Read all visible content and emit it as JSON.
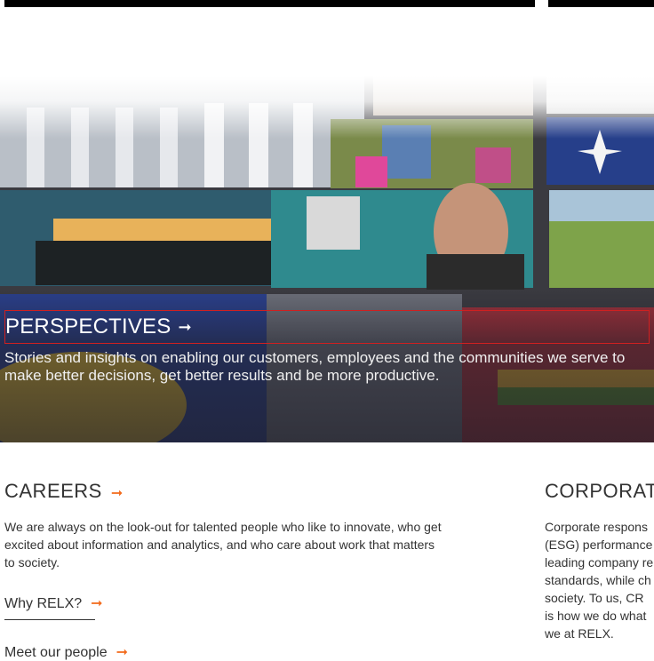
{
  "hero": {
    "title": "PERSPECTIVES",
    "arrow": "➞",
    "description": "Stories and insights on enabling our customers, employees and the communities we serve to make better decisions, get better results and be more productive."
  },
  "careers": {
    "title": "CAREERS",
    "arrow": "➞",
    "body": "We are always on the look-out for talented people who like to innovate, who get excited about information and analytics, and who care about work that matters to society.",
    "link1": "Why RELX?",
    "link2": "Meet our people"
  },
  "corporate": {
    "title": "CORPORATE",
    "body": "Corporate respons (ESG) performance leading company re standards, while ch society. To us, CR is how we do what we at RELX."
  },
  "colors": {
    "accent": "#f26b1d",
    "highlight_border": "#d02020"
  }
}
